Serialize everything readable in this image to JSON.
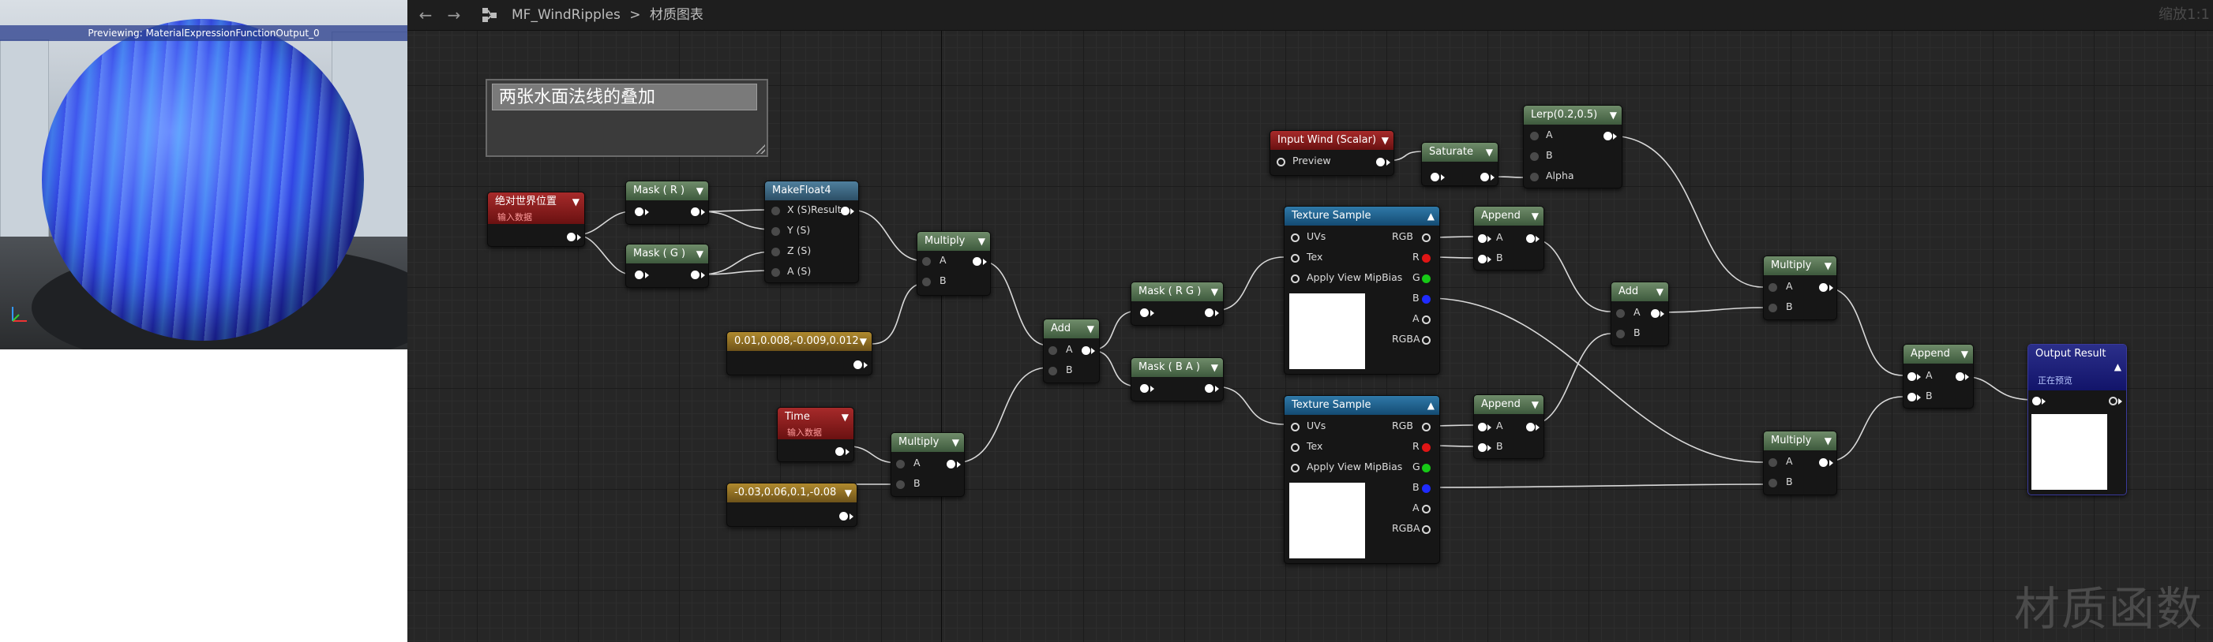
{
  "preview": {
    "banner": "Previewing: MaterialExpressionFunctionOutput_0"
  },
  "toolbar": {
    "back_icon": "arrow-left-icon",
    "forward_icon": "arrow-right-icon",
    "graph_icon": "material-graph-icon",
    "asset_name": "MF_WindRipples",
    "separator": ">",
    "graph_name": "材质图表",
    "zoom": "缩放1:1"
  },
  "watermark": "材质函数",
  "comment": {
    "title": "两张水面法线的叠加"
  },
  "nodes": {
    "absolute_position": {
      "title": "绝对世界位置",
      "subtitle": "输入数据"
    },
    "mask_r": {
      "title": "Mask ( R )"
    },
    "mask_g": {
      "title": "Mask ( G )"
    },
    "make_float4": {
      "title": "MakeFloat4",
      "pins": [
        "X (S)",
        "Y (S)",
        "Z (S)",
        "A (S)"
      ],
      "output": "Result"
    },
    "multiply_1": {
      "title": "Multiply",
      "pins": [
        "A",
        "B"
      ]
    },
    "constant_1": {
      "title": "0.01,0.008,-0.009,0.012"
    },
    "time": {
      "title": "Time",
      "subtitle": "输入数据"
    },
    "multiply_2": {
      "title": "Multiply",
      "pins": [
        "A",
        "B"
      ]
    },
    "constant_2": {
      "title": "-0.03,0.06,0.1,-0.08"
    },
    "add_1": {
      "title": "Add",
      "pins": [
        "A",
        "B"
      ]
    },
    "mask_rg": {
      "title": "Mask ( R G )"
    },
    "mask_ba": {
      "title": "Mask ( B A )"
    },
    "input_wind": {
      "title": "Input Wind (Scalar)",
      "pins": [
        "Preview"
      ]
    },
    "saturate": {
      "title": "Saturate"
    },
    "lerp": {
      "title": "Lerp(0.2,0.5)",
      "pins": [
        "A",
        "B",
        "Alpha"
      ]
    },
    "texture_sample_1": {
      "title": "Texture Sample",
      "inputs": [
        "UVs",
        "Tex",
        "Apply View MipBias"
      ],
      "outputs": [
        "RGB",
        "R",
        "G",
        "B",
        "A",
        "RGBA"
      ]
    },
    "texture_sample_2": {
      "title": "Texture Sample",
      "inputs": [
        "UVs",
        "Tex",
        "Apply View MipBias"
      ],
      "outputs": [
        "RGB",
        "R",
        "G",
        "B",
        "A",
        "RGBA"
      ]
    },
    "append_1": {
      "title": "Append",
      "pins": [
        "A",
        "B"
      ]
    },
    "append_2": {
      "title": "Append",
      "pins": [
        "A",
        "B"
      ]
    },
    "add_2": {
      "title": "Add",
      "pins": [
        "A",
        "B"
      ]
    },
    "multiply_3": {
      "title": "Multiply",
      "pins": [
        "A",
        "B"
      ]
    },
    "multiply_4": {
      "title": "Multiply",
      "pins": [
        "A",
        "B"
      ]
    },
    "append_3": {
      "title": "Append",
      "pins": [
        "A",
        "B"
      ]
    },
    "output_result": {
      "title": "Output Result",
      "subtitle": "正在预览"
    }
  },
  "colors": {
    "pin_red": "#e01515",
    "pin_green": "#16c916",
    "pin_blue": "#1f2bff",
    "wire": "#d9d9d9"
  }
}
